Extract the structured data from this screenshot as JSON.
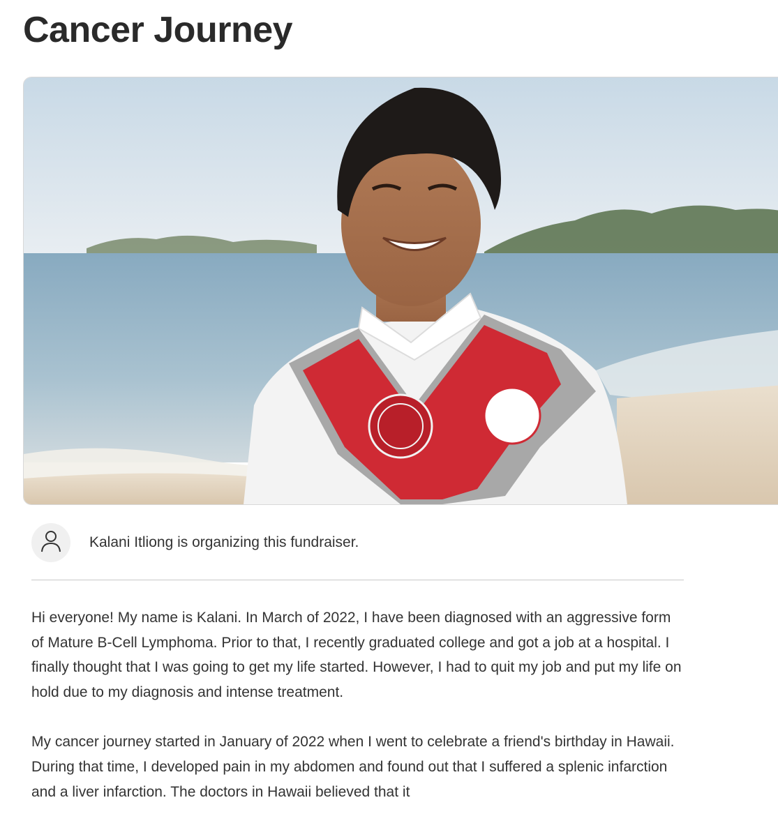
{
  "campaign": {
    "title": "Cancer Journey"
  },
  "organizer": {
    "avatar_icon": "user-icon",
    "text": "Kalani Itliong is organizing this fundraiser."
  },
  "story": {
    "paragraph_1": "Hi everyone! My name is Kalani. In March of 2022, I have been diagnosed with an aggressive form of Mature B-Cell Lymphoma. Prior to that, I recently graduated college and got a job at a hospital. I finally thought that I was going to get my life started. However, I had to quit my job and put my life on hold due to my diagnosis and intense treatment.",
    "paragraph_2": "My cancer journey started in January of 2022 when I went to celebrate a friend's birthday in Hawaii. During that time, I developed pain in my abdomen and found out that I suffered a splenic infarction and a liver infarction. The doctors in Hawaii believed that it"
  },
  "colors": {
    "sky": "#dbe6ee",
    "ocean": "#8fb0c4",
    "sand": "#e9dccb",
    "stole_red": "#cf2a34",
    "stole_trim": "#a9a9a9",
    "gown": "#f4f4f4"
  }
}
